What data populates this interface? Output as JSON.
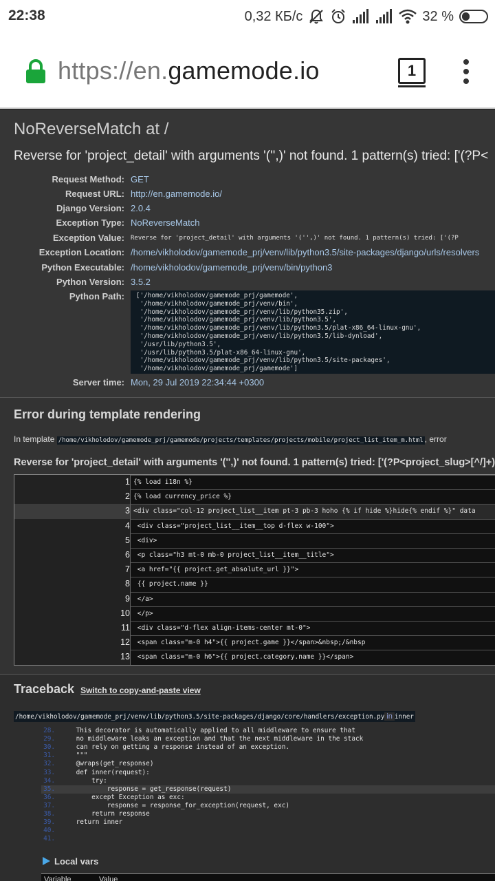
{
  "statusbar": {
    "time": "22:38",
    "net_speed": "0,32 КБ/с",
    "battery_pct": "32 %",
    "battery_level": 0.32,
    "icons": [
      "mute-icon",
      "alarm-icon",
      "signal-icon",
      "signal-icon",
      "wifi-icon",
      "battery-icon"
    ]
  },
  "browser": {
    "url_scheme": "https://en.",
    "url_host": "gamemode.io",
    "tab_count": "1"
  },
  "error": {
    "title": "NoReverseMatch at /",
    "value": "Reverse for 'project_detail' with arguments '('',)' not found. 1 pattern(s) tried: ['(?P<"
  },
  "meta": [
    {
      "label": "Request Method:",
      "value": "GET"
    },
    {
      "label": "Request URL:",
      "value": "http://en.gamemode.io/"
    },
    {
      "label": "Django Version:",
      "value": "2.0.4"
    },
    {
      "label": "Exception Type:",
      "value": "NoReverseMatch"
    },
    {
      "label": "Exception Value:",
      "value": "Reverse for 'project_detail' with arguments '('',)' not found. 1 pattern(s) tried: ['(?P"
    },
    {
      "label": "Exception Location:",
      "value": "/home/vikholodov/gamemode_prj/venv/lib/python3.5/site-packages/django/urls/resolvers"
    },
    {
      "label": "Python Executable:",
      "value": "/home/vikholodov/gamemode_prj/venv/bin/python3"
    },
    {
      "label": "Python Version:",
      "value": "3.5.2"
    },
    {
      "label": "Python Path:",
      "value": "['/home/vikholodov/gamemode_prj/gamemode',\n '/home/vikholodov/gamemode_prj/venv/bin',\n '/home/vikholodov/gamemode_prj/venv/lib/python35.zip',\n '/home/vikholodov/gamemode_prj/venv/lib/python3.5',\n '/home/vikholodov/gamemode_prj/venv/lib/python3.5/plat-x86_64-linux-gnu',\n '/home/vikholodov/gamemode_prj/venv/lib/python3.5/lib-dynload',\n '/usr/lib/python3.5',\n '/usr/lib/python3.5/plat-x86_64-linux-gnu',\n '/home/vikholodov/gamemode_prj/venv/lib/python3.5/site-packages',\n '/home/vikholodov/gamemode_prj/gamemode']"
    },
    {
      "label": "Server time:",
      "value": "Mon, 29 Jul 2019 22:34:44 +0300"
    }
  ],
  "template_error": {
    "heading": "Error during template rendering",
    "in_template_prefix": "In template ",
    "template_path": "/home/vikholodov/gamemode_prj/gamemode/projects/templates/projects/mobile/project_list_item_m.html",
    "in_template_suffix": ", error",
    "reverse_msg": "Reverse for 'project_detail' with arguments '('',)' not found. 1 pattern(s) tried: ['(?P<project_slug>[^/]+)\\/",
    "lines": [
      {
        "num": "1",
        "code": "{% load i18n %}"
      },
      {
        "num": "2",
        "code": "{% load currency_price %}"
      },
      {
        "num": "3",
        "code": "<div class=\"col-12 project_list__item pt-3 pb-3 hoho {% if hide %}hide{% endif %}\" data"
      },
      {
        "num": "4",
        "code": " <div class=\"project_list__item__top d-flex w-100\">"
      },
      {
        "num": "5",
        "code": " <div>"
      },
      {
        "num": "6",
        "code": " <p class=\"h3 mt-0 mb-0 project_list__item__title\">"
      },
      {
        "num": "7",
        "code": " <a href=\"{{ project.get_absolute_url }}\">"
      },
      {
        "num": "8",
        "code": " {{ project.name }}"
      },
      {
        "num": "9",
        "code": " </a>"
      },
      {
        "num": "10",
        "code": " </p>"
      },
      {
        "num": "11",
        "code": " <div class=\"d-flex align-items-center mt-0\">"
      },
      {
        "num": "12",
        "code": " <span class=\"m-0 h4\">{{ project.game }}</span>&nbsp;/&nbsp"
      },
      {
        "num": "13",
        "code": " <span class=\"m-0 h6\">{{ project.category.name }}</span>"
      }
    ]
  },
  "traceback": {
    "heading": "Traceback",
    "switch_link": "Switch to copy-and-paste view",
    "file_path": "/home/vikholodov/gamemode_prj/venv/lib/python3.5/site-packages/django/core/handlers/exception.py",
    "in_word": "in",
    "func": "inner",
    "lines": [
      {
        "num": "28.",
        "code": "    This decorator is automatically applied to all middleware to ensure that"
      },
      {
        "num": "29.",
        "code": "    no middleware leaks an exception and that the next middleware in the stack"
      },
      {
        "num": "30.",
        "code": "    can rely on getting a response instead of an exception."
      },
      {
        "num": "31.",
        "code": "    \"\"\""
      },
      {
        "num": "32.",
        "code": "    @wraps(get_response)"
      },
      {
        "num": "33.",
        "code": "    def inner(request):"
      },
      {
        "num": "34.",
        "code": "        try:"
      },
      {
        "num": "35.",
        "code": "            response = get_response(request)"
      },
      {
        "num": "36.",
        "code": "        except Exception as exc:"
      },
      {
        "num": "37.",
        "code": "            response = response_for_exception(request, exc)"
      },
      {
        "num": "38.",
        "code": "        return response"
      },
      {
        "num": "39.",
        "code": "    return inner"
      },
      {
        "num": "40.",
        "code": ""
      },
      {
        "num": "41.",
        "code": ""
      }
    ],
    "local_vars": "Local vars",
    "vars_cols": [
      "Variable",
      "Value"
    ]
  }
}
